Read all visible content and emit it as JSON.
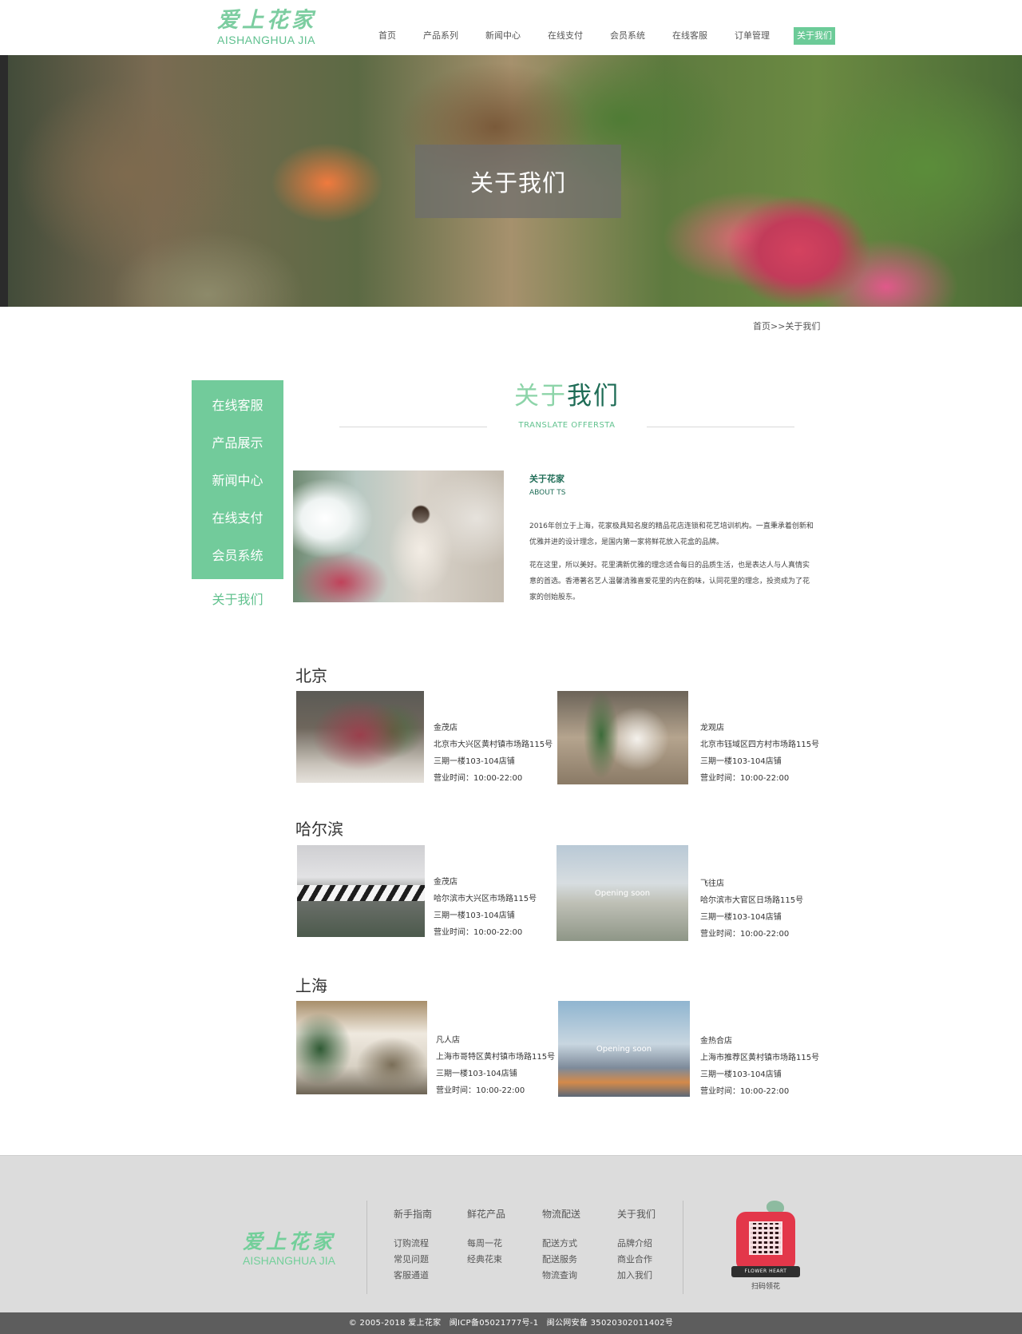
{
  "header": {
    "logo_cn": "爱上花家",
    "logo_en": "AISHANGHUA JIA",
    "nav": [
      "首页",
      "产品系列",
      "新闻中心",
      "在线支付",
      "会员系统",
      "在线客服",
      "订单管理",
      "关于我们"
    ],
    "active_nav": "关于我们"
  },
  "banner": {
    "title": "关于我们"
  },
  "breadcrumb": "首页>>关于我们",
  "sidebar": {
    "items": [
      "在线客服",
      "产品展示",
      "新闻中心",
      "在线支付",
      "会员系统"
    ],
    "current": "关于我们"
  },
  "section": {
    "title_part1": "关于",
    "title_part2": "我们",
    "subtitle": "TRANSLATE OFFERSTA"
  },
  "about": {
    "heading": "关于花家",
    "sub": "ABOUT TS",
    "p1": "2016年创立于上海，花家极具知名度的精品花店连锁和花艺培训机构。一直秉承着创新和优雅并进的设计理念，是国内第一家将鲜花放入花盒的品牌。",
    "p2": "花在这里，所以美好。花里满新优雅的理念适合每日的品质生活，也是表达人与人真情实意的首选。香港著名艺人温馨清雅喜爱花里的内在韵味，认同花里的理念，投资成为了花家的创始股东。"
  },
  "cities": [
    {
      "name": "北京",
      "stores": [
        {
          "name": "金茂店",
          "address": "北京市大兴区黄村镇市场路115号",
          "floor": "三期一楼103-104店铺",
          "hours": "营业时间：10:00-22:00"
        },
        {
          "name": "龙观店",
          "address": "北京市钰域区四方村市场路115号",
          "floor": "三期一楼103-104店铺",
          "hours": "营业时间：10:00-22:00"
        }
      ]
    },
    {
      "name": "哈尔滨",
      "stores": [
        {
          "name": "金茂店",
          "address": "哈尔滨市大兴区市场路115号",
          "floor": "三期一楼103-104店铺",
          "hours": "营业时间：10:00-22:00"
        },
        {
          "name": "飞往店",
          "address": "哈尔滨市大官区日场路115号",
          "floor": "三期一楼103-104店铺",
          "hours": "营业时间：10:00-22:00",
          "overlay": "Opening soon"
        }
      ]
    },
    {
      "name": "上海",
      "stores": [
        {
          "name": "凡人店",
          "address": "上海市哥特区黄村镇市场路115号",
          "floor": "三期一楼103-104店铺",
          "hours": "营业时间：10:00-22:00"
        },
        {
          "name": "金热合店",
          "address": "上海市推荐区黄村镇市场路115号",
          "floor": "三期一楼103-104店铺",
          "hours": "营业时间：10:00-22:00",
          "overlay": "Opening soon"
        }
      ]
    }
  ],
  "footer": {
    "logo_cn": "爱上花家",
    "logo_en": "AISHANGHUA JIA",
    "columns": [
      {
        "title": "新手指南",
        "links": [
          "订购流程",
          "常见问题",
          "客服通道"
        ]
      },
      {
        "title": "鲜花产品",
        "links": [
          "每周一花",
          "经典花束"
        ]
      },
      {
        "title": "物流配送",
        "links": [
          "配送方式",
          "配送服务",
          "物流查询"
        ]
      },
      {
        "title": "关于我们",
        "links": [
          "品牌介绍",
          "商业合作",
          "加入我们"
        ]
      }
    ],
    "qr_ribbon": "FLOWER HEART",
    "qr_caption": "扫码领花",
    "copyright": "© 2005-2018 爱上花家　闽ICP备05021777号-1　闽公网安备 35020302011402号"
  }
}
